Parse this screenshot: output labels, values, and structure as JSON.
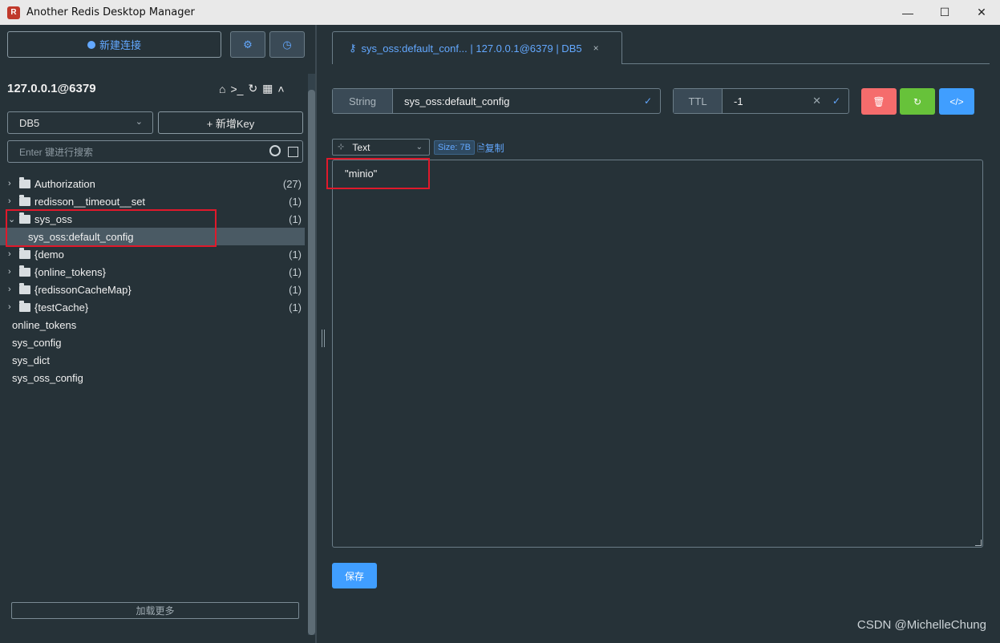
{
  "window": {
    "title": "Another Redis Desktop Manager",
    "minimize": "—",
    "maximize": "☐",
    "close": "✕"
  },
  "sidebar": {
    "new_connection": "新建连接",
    "settings_icon": "⚙",
    "history_icon": "◷",
    "server": "127.0.0.1@6379",
    "db_selected": "DB5",
    "add_key": "+ 新增Key",
    "search_placeholder": "Enter 键进行搜索",
    "tree": [
      {
        "label": "Authorization",
        "count": "(27)"
      },
      {
        "label": "redisson__timeout__set",
        "count": "(1)"
      },
      {
        "label": "sys_oss",
        "count": "(1)"
      },
      {
        "label": "sys_oss:default_config"
      },
      {
        "label": "{demo",
        "count": "(1)"
      },
      {
        "label": "{online_tokens}",
        "count": "(1)"
      },
      {
        "label": "{redissonCacheMap}",
        "count": "(1)"
      },
      {
        "label": "{testCache}",
        "count": "(1)"
      },
      {
        "label": "online_tokens"
      },
      {
        "label": "sys_config"
      },
      {
        "label": "sys_dict"
      },
      {
        "label": "sys_oss_config"
      }
    ],
    "load_more": "加载更多"
  },
  "tab": {
    "label": "sys_oss:default_conf... | 127.0.0.1@6379 | DB5",
    "close": "×"
  },
  "key_bar": {
    "type": "String",
    "key": "sys_oss:default_config",
    "ttl_label": "TTL",
    "ttl_value": "-1"
  },
  "viewer": {
    "format": "Text",
    "size": "Size: 7B",
    "copy": "复制",
    "value": "\"minio\""
  },
  "save": "保存",
  "watermark": "CSDN @MichelleChung",
  "colors": {
    "accent": "#409eff",
    "delete": "#f56c6c",
    "refresh": "#67c23a",
    "highlight": "#e0192b"
  }
}
